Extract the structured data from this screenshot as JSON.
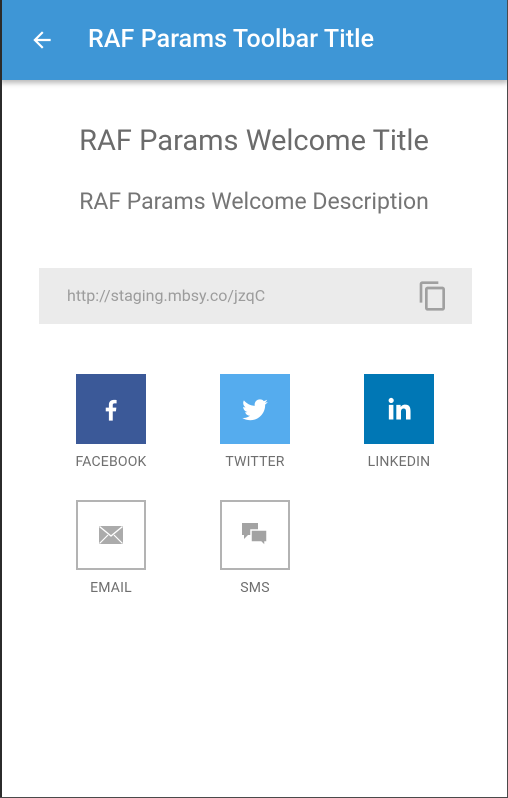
{
  "toolbar": {
    "title": "RAF Params Toolbar Title",
    "back_icon": "arrow-left-icon",
    "color": "#3e96d6"
  },
  "welcome": {
    "title": "RAF Params Welcome Title",
    "description": "RAF Params Welcome Description"
  },
  "share_link": {
    "url": "http://staging.mbsy.co/jzqC",
    "copy_icon": "copy-icon"
  },
  "share_options": [
    {
      "label": "FACEBOOK",
      "icon": "facebook-icon",
      "color": "#3b5998"
    },
    {
      "label": "TWITTER",
      "icon": "twitter-icon",
      "color": "#55acee"
    },
    {
      "label": "LINKEDIN",
      "icon": "linkedin-icon",
      "color": "#0077b5"
    },
    {
      "label": "EMAIL",
      "icon": "mail-icon",
      "color": "#b3b3b3"
    },
    {
      "label": "SMS",
      "icon": "chat-bubbles-icon",
      "color": "#b3b3b3"
    }
  ]
}
